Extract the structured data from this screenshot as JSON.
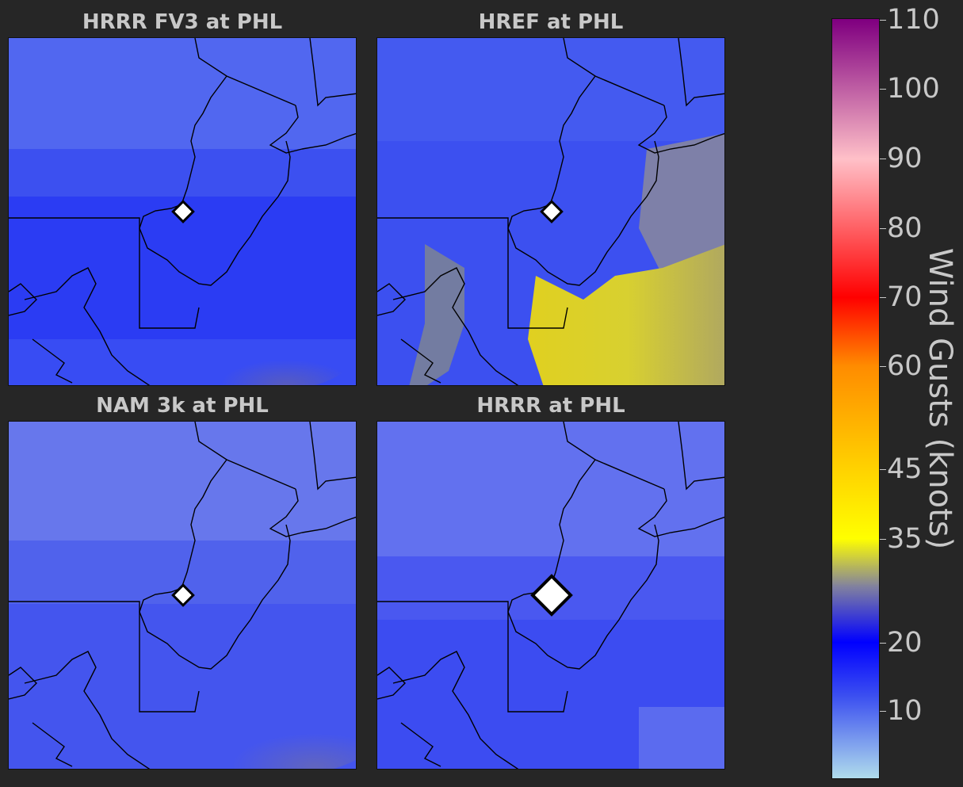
{
  "panels": [
    {
      "id": "fv3",
      "title": "HRRR FV3 at PHL"
    },
    {
      "id": "href",
      "title": "HREF at PHL"
    },
    {
      "id": "nam",
      "title": "NAM 3k at PHL"
    },
    {
      "id": "hrrr",
      "title": "HRRR at PHL"
    }
  ],
  "colorbar": {
    "label": "Wind Gusts (knots)",
    "min": 0,
    "max": 110,
    "ticks": [
      "10",
      "20",
      "35",
      "45",
      "60",
      "70",
      "80",
      "90",
      "100",
      "110"
    ],
    "colors": {
      "light": "#b0dcec",
      "blue": "#0000ff",
      "gray": "#8080a0",
      "yellow": "#ffff00",
      "gold": "#ffd200",
      "orange": "#ff8c00",
      "red": "#ff0000",
      "pink": "#ffc0c8",
      "purple": "#800080"
    }
  },
  "marker": {
    "station": "PHL",
    "color": "#ffffff",
    "outline": "#000000"
  }
}
